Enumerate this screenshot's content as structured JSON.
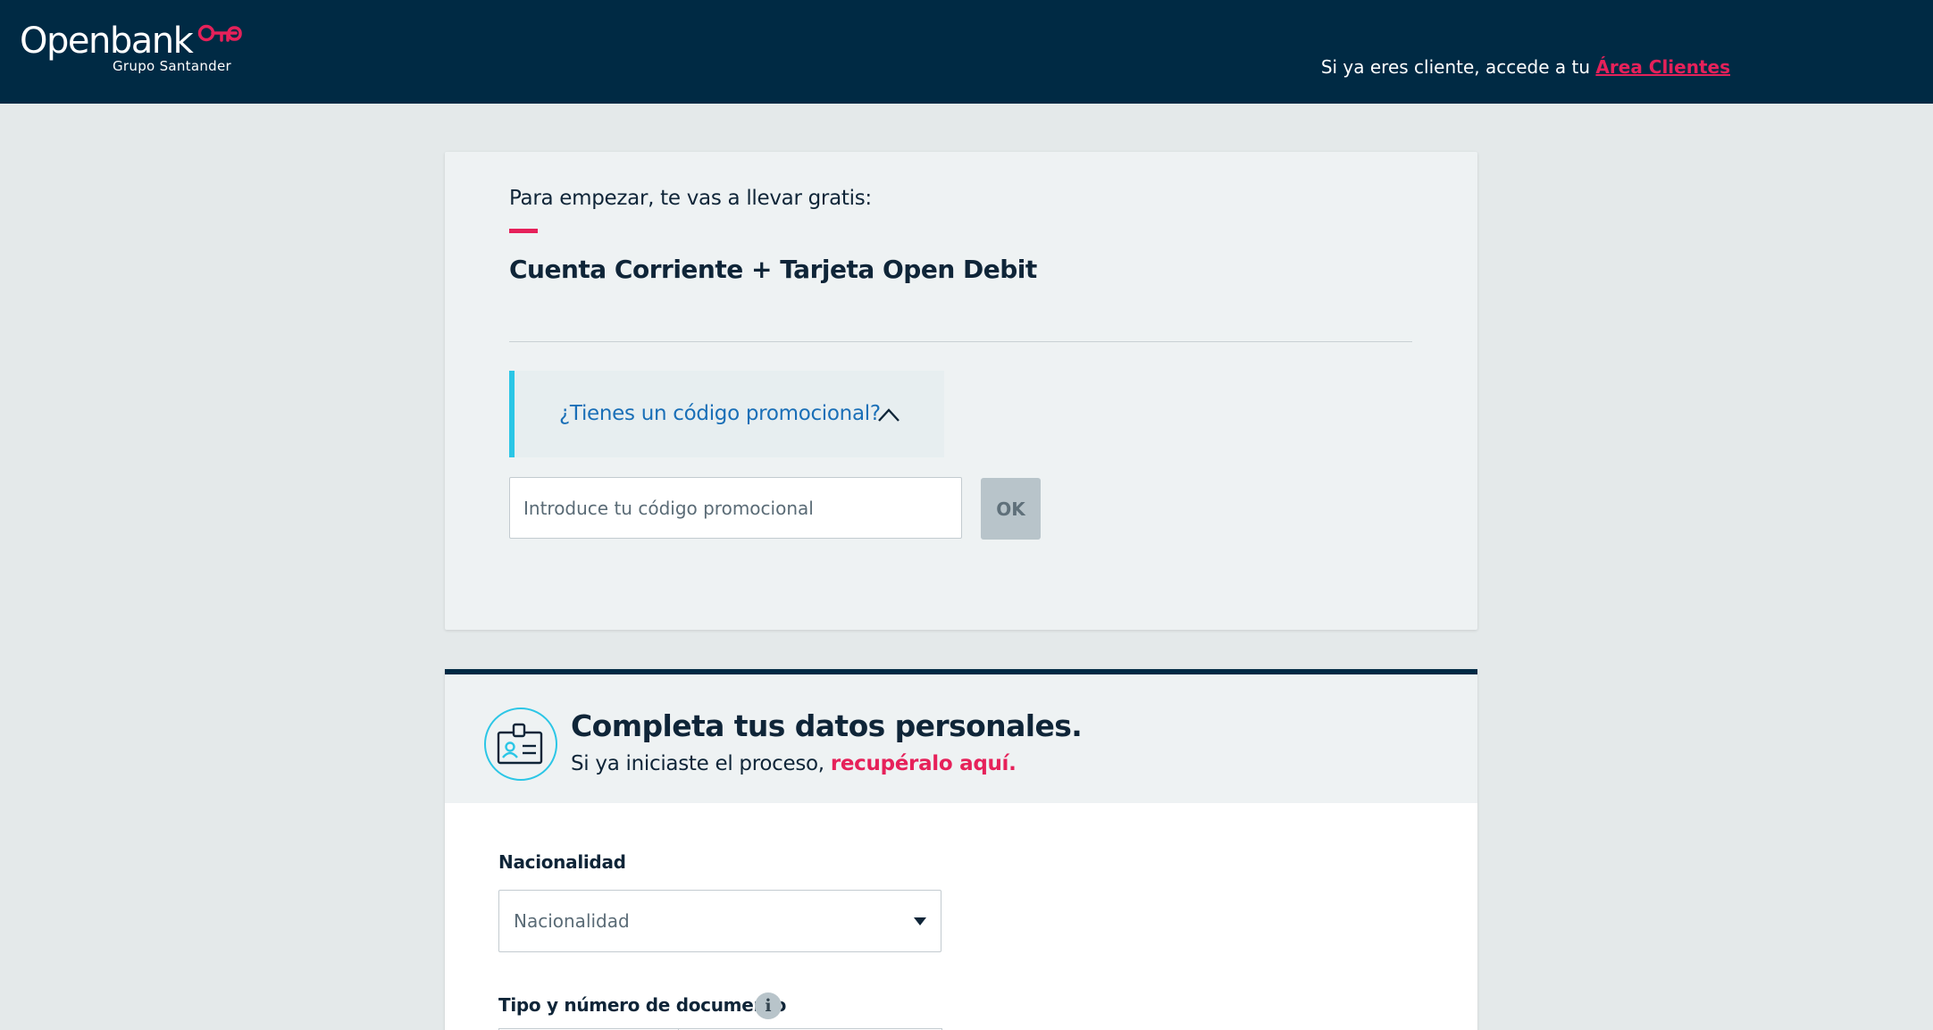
{
  "header": {
    "brand": "Openbank",
    "brand_sub": "Grupo Santander",
    "client_prompt": "Si ya eres cliente, accede a tu",
    "client_link": "Área Clientes",
    "bg_color": "#002a44",
    "accent_color": "#e6215a"
  },
  "promo_card": {
    "intro": "Para empezar, te vas a llevar gratis:",
    "product": "Cuenta Corriente + Tarjeta Open Debit",
    "promo_question": "¿Tienes un código promocional?",
    "promo_placeholder": "Introduce tu código promocional",
    "ok_label": "OK"
  },
  "personal_card": {
    "title": "Completa tus datos personales.",
    "subtitle_prefix": "Si ya iniciaste el proceso,",
    "subtitle_link": "recupéralo aquí.",
    "nationality_label": "Nacionalidad",
    "nationality_value": "Nacionalidad",
    "document_label": "Tipo y número de documento",
    "info_glyph": "i"
  }
}
